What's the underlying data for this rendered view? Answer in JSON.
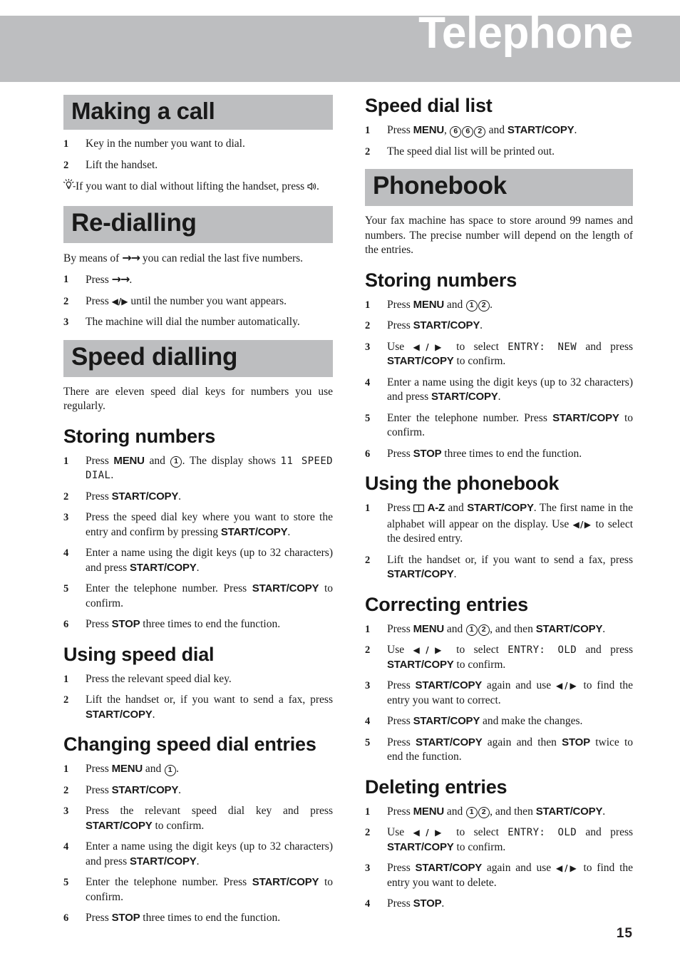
{
  "header": {
    "title": "Telephone",
    "band_color": "#bdbec0"
  },
  "page_number": "15",
  "icons": {
    "tip": "lightbulb-icon",
    "speaker": "speaker-icon",
    "phonebook": "open-book-icon"
  },
  "left_column": {
    "making_a_call": {
      "heading": "Making a call",
      "steps": [
        {
          "num": "1",
          "pre": "Key in the number you want to dial."
        },
        {
          "num": "2",
          "pre": "Lift the handset."
        }
      ],
      "tip_pre": "If you want to dial without lifting the handset, press",
      "tip_post": "."
    },
    "re_dialling": {
      "heading": "Re-dialling",
      "intro_pre": "By means of",
      "intro_arrows": "→→",
      "intro_post": "you can redial the last five numbers.",
      "steps": [
        {
          "num": "1",
          "pre": "Press",
          "arrows": "→→",
          "post": "."
        },
        {
          "num": "2",
          "pre": "Press",
          "lr": "◀/▶",
          "post": "until the number you want appears."
        },
        {
          "num": "3",
          "pre": "The machine will dial the number automatically."
        }
      ]
    },
    "speed_dialling": {
      "heading": "Speed dialling",
      "intro": "There are eleven speed dial keys for numbers you use regularly.",
      "storing_numbers": {
        "heading": "Storing numbers",
        "steps": [
          {
            "num": "1",
            "a": "Press",
            "key1": "MENU",
            "b": "and",
            "circ1": "1",
            "c": ". The display shows",
            "lcd1": "11  SPEED DIAL",
            "d": "."
          },
          {
            "num": "2",
            "a": "Press",
            "key1": "START/COPY",
            "b": "."
          },
          {
            "num": "3",
            "a": "Press the speed dial key where you want to store the entry and confirm by pressing",
            "key1": "START/COPY",
            "b": "."
          },
          {
            "num": "4",
            "a": "Enter a name using the digit keys (up to 32 characters) and press",
            "key1": "START/COPY",
            "b": "."
          },
          {
            "num": "5",
            "a": "Enter the telephone number. Press",
            "key1": "START/COPY",
            "b": "to confirm."
          },
          {
            "num": "6",
            "a": "Press",
            "key1": "STOP",
            "b": "three times to end the function."
          }
        ]
      },
      "using_speed_dial": {
        "heading": "Using speed dial",
        "steps": [
          {
            "num": "1",
            "a": "Press the relevant speed dial key."
          },
          {
            "num": "2",
            "a": "Lift the handset or, if you want to send a fax, press",
            "key1": "START/COPY",
            "b": "."
          }
        ]
      },
      "changing_speed_dial_entries": {
        "heading": "Changing speed dial entries",
        "steps": [
          {
            "num": "1",
            "a": "Press",
            "key1": "MENU",
            "b": "and",
            "circ1": "1",
            "c": "."
          },
          {
            "num": "2",
            "a": "Press",
            "key1": "START/COPY",
            "b": "."
          },
          {
            "num": "3",
            "a": "Press the relevant speed dial key and press",
            "key1": "START/COPY",
            "b": "to confirm."
          },
          {
            "num": "4",
            "a": "Enter a name using the digit keys (up to 32 characters) and press",
            "key1": "START/COPY",
            "b": "."
          },
          {
            "num": "5",
            "a": "Enter the telephone number. Press",
            "key1": "START/COPY",
            "b": "to confirm."
          },
          {
            "num": "6",
            "a": "Press",
            "key1": "STOP",
            "b": "three times to end the function."
          }
        ]
      }
    }
  },
  "right_column": {
    "speed_dial_list": {
      "heading": "Speed dial list",
      "steps": [
        {
          "num": "1",
          "a": "Press",
          "key1": "MENU",
          "b": ",",
          "circ1": "6",
          "circ2": "6",
          "circ3": "2",
          "c": "and",
          "key2": "START/COPY",
          "d": "."
        },
        {
          "num": "2",
          "a": "The speed dial list will be printed out."
        }
      ]
    },
    "phonebook": {
      "heading": "Phonebook",
      "intro": "Your fax machine has space to store around 99 names and numbers. The precise number will depend on the length of the entries.",
      "storing_numbers": {
        "heading": "Storing numbers",
        "steps": [
          {
            "num": "1",
            "a": "Press",
            "key1": "MENU",
            "b": "and",
            "circ1": "1",
            "circ2": "2",
            "c": "."
          },
          {
            "num": "2",
            "a": "Press",
            "key1": "START/COPY",
            "b": "."
          },
          {
            "num": "3",
            "a": "Use",
            "lr": "◀/▶",
            "b": "to select",
            "lcd1": "ENTRY:  NEW",
            "c": "and press",
            "key1": "START/COPY",
            "d": "to confirm."
          },
          {
            "num": "4",
            "a": "Enter a name using the digit keys (up to 32 characters) and press",
            "key1": "START/COPY",
            "b": "."
          },
          {
            "num": "5",
            "a": "Enter the telephone number. Press",
            "key1": "START/COPY",
            "b": "to confirm."
          },
          {
            "num": "6",
            "a": "Press",
            "key1": "STOP",
            "b": "three times to end the function."
          }
        ]
      },
      "using_the_phonebook": {
        "heading": "Using the phonebook",
        "steps": [
          {
            "num": "1",
            "a": "Press",
            "key1": "A-Z",
            "b": "and",
            "key2": "START/COPY",
            "c": ". The first name in the alphabet will appear on the display. Use",
            "lr": "◀/▶",
            "d": "to select the desired entry."
          },
          {
            "num": "2",
            "a": "Lift the handset or, if you want to send a fax, press",
            "key1": "START/COPY",
            "b": "."
          }
        ]
      },
      "correcting_entries": {
        "heading": "Correcting entries",
        "steps": [
          {
            "num": "1",
            "a": "Press",
            "key1": "MENU",
            "b": "and",
            "circ1": "1",
            "circ2": "2",
            "c": ", and then",
            "key2": "START/COPY",
            "d": "."
          },
          {
            "num": "2",
            "a": "Use",
            "lr": "◀/▶",
            "b": "to select",
            "lcd1": "ENTRY:  OLD",
            "c": "and press",
            "key1": "START/COPY",
            "d": "to confirm."
          },
          {
            "num": "3",
            "a": "Press",
            "key1": "START/COPY",
            "b": "again and use",
            "lr": "◀/▶",
            "c": "to find the entry you want to correct."
          },
          {
            "num": "4",
            "a": "Press",
            "key1": "START/COPY",
            "b": "and make the changes."
          },
          {
            "num": "5",
            "a": "Press",
            "key1": "START/COPY",
            "b": "again and then",
            "key2": "STOP",
            "c": "twice to end the function."
          }
        ]
      },
      "deleting_entries": {
        "heading": "Deleting entries",
        "steps": [
          {
            "num": "1",
            "a": "Press",
            "key1": "MENU",
            "b": "and",
            "circ1": "1",
            "circ2": "2",
            "c": ", and then",
            "key2": "START/COPY",
            "d": "."
          },
          {
            "num": "2",
            "a": "Use",
            "lr": "◀/▶",
            "b": "to select",
            "lcd1": "ENTRY:  OLD",
            "c": "and press",
            "key1": "START/COPY",
            "d": "to confirm."
          },
          {
            "num": "3",
            "a": "Press",
            "key1": "START/COPY",
            "b": "again and use",
            "lr": "◀/▶",
            "c": "to find the entry you want to delete."
          },
          {
            "num": "4",
            "a": "Press",
            "key1": "STOP",
            "b": "."
          }
        ]
      }
    }
  }
}
